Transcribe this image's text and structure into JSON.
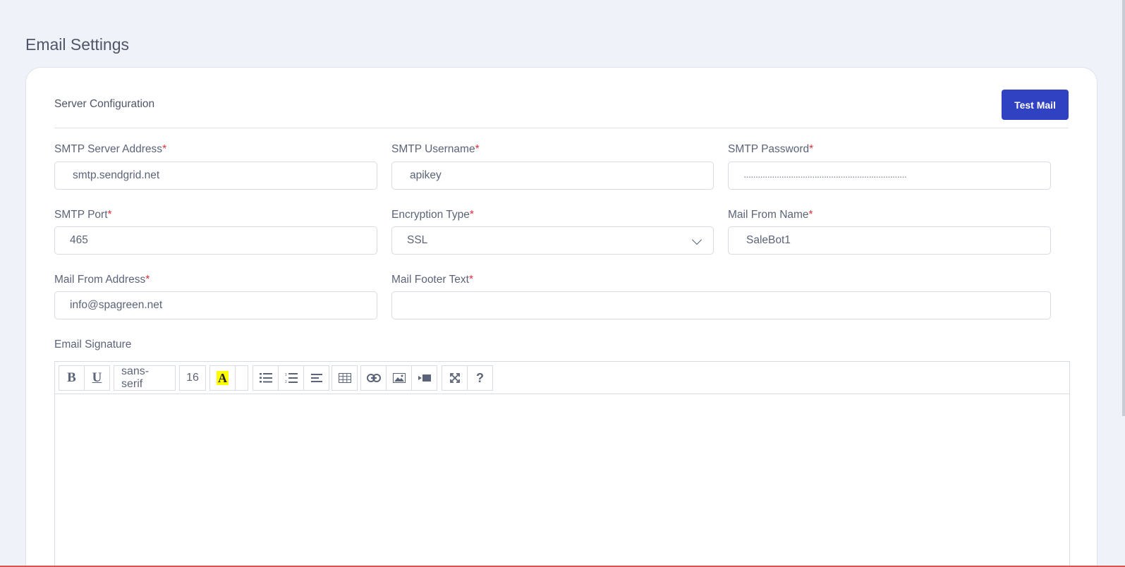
{
  "page": {
    "title": "Email Settings"
  },
  "section": {
    "heading": "Server Configuration",
    "test_mail_label": "Test Mail"
  },
  "fields": {
    "smtp_server": {
      "label": "SMTP Server Address",
      "required": "*",
      "value": "smtp.sendgrid.net"
    },
    "smtp_username": {
      "label": "SMTP Username",
      "required": "*",
      "value": "apikey"
    },
    "smtp_password": {
      "label": "SMTP Password",
      "required": "*",
      "value": "․․․․․․․․․․․․․․․․․․․․․․․․․․․․․․․․․․․․․․․․․․․․․․․․․․․․․․․․․․․․․․․․․․․․․"
    },
    "smtp_port": {
      "label": "SMTP Port",
      "required": "*",
      "value": "465"
    },
    "encryption_type": {
      "label": "Encryption Type",
      "required": "*",
      "value": "SSL"
    },
    "mail_from_name": {
      "label": "Mail From Name",
      "required": "*",
      "value": "SaleBot1"
    },
    "mail_from_address": {
      "label": "Mail From Address",
      "required": "*",
      "value": "info@spagreen.net"
    },
    "mail_footer_text": {
      "label": "Mail Footer Text",
      "required": "*",
      "value": ""
    },
    "email_signature": {
      "label": "Email Signature"
    }
  },
  "editor": {
    "toolbar": {
      "bold": "B",
      "underline": "U",
      "font_family": "sans-serif",
      "font_size": "16",
      "highlight": "A",
      "icons": [
        "bold-icon",
        "underline-icon",
        "unordered-list-icon",
        "ordered-list-icon",
        "align-icon",
        "table-icon",
        "link-icon",
        "image-icon",
        "video-icon",
        "fullscreen-icon",
        "help-icon"
      ],
      "help": "?"
    },
    "content": ""
  },
  "colors": {
    "accent": "#3041c2",
    "required": "#e0303a",
    "background": "#eff2f9"
  }
}
